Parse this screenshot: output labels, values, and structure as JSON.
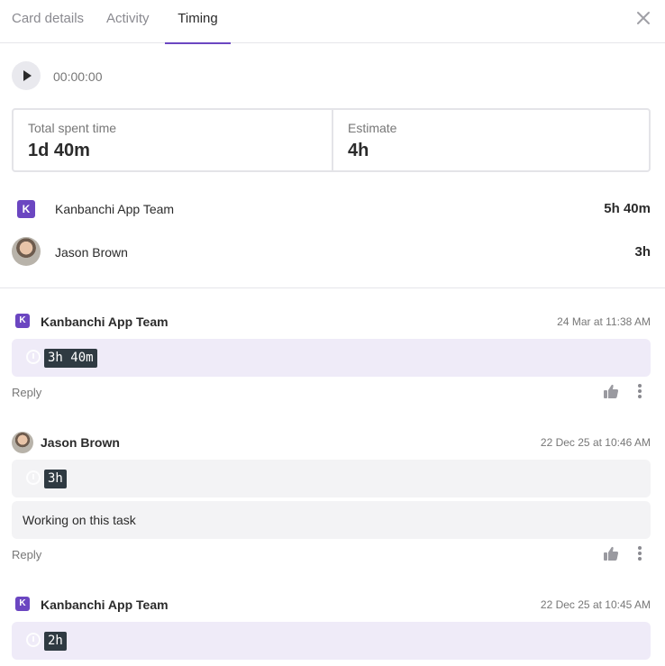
{
  "tabs": [
    {
      "label": "Card details"
    },
    {
      "label": "Activity"
    },
    {
      "label": "Timing",
      "active": true
    }
  ],
  "timer": {
    "display": "00:00:00"
  },
  "summary": {
    "total_label": "Total spent time",
    "total_value": "1d 40m",
    "estimate_label": "Estimate",
    "estimate_value": "4h"
  },
  "users": [
    {
      "badge": "K",
      "name": "Kanbanchi App Team",
      "total": "5h 40m"
    },
    {
      "name": "Jason Brown",
      "total": "3h"
    }
  ],
  "entries": [
    {
      "badge": "K",
      "author": "Kanbanchi App Team",
      "timestamp": "24 Mar at 11:38 AM",
      "duration": "3h 40m",
      "reply": "Reply"
    },
    {
      "author": "Jason Brown",
      "timestamp": "22 Dec 25 at 10:46 AM",
      "duration": "3h",
      "comment": "Working on this task",
      "reply": "Reply"
    },
    {
      "badge": "K",
      "author": "Kanbanchi App Team",
      "timestamp": "22 Dec 25 at 10:45 AM",
      "duration": "2h"
    }
  ],
  "colors": {
    "accent": "#6b46c1",
    "purple_bubble": "#efebf8",
    "gray_bubble": "#f3f3f5",
    "chip": "#2f3a42"
  }
}
